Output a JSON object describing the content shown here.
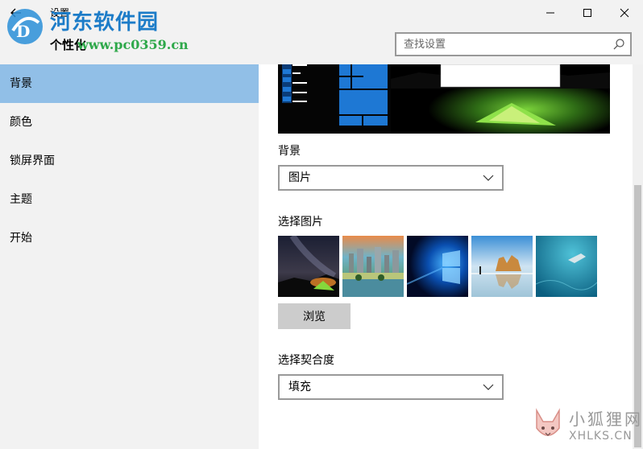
{
  "window": {
    "app_title": "设置",
    "page_title": "个性化",
    "back_icon": "back-arrow-icon",
    "min_icon": "minimize-icon",
    "max_icon": "maximize-icon",
    "close_icon": "close-icon"
  },
  "watermark": {
    "site_title": "河东软件园",
    "site_url": "www.pc0359.cn",
    "corner_cn": "小狐狸网",
    "corner_en": "XHLKS.CN"
  },
  "search": {
    "placeholder": "查找设置",
    "icon": "search-icon"
  },
  "sidebar": {
    "selected_index": 0,
    "accent": "#91bfe7",
    "items": [
      {
        "label": "背景"
      },
      {
        "label": "颜色"
      },
      {
        "label": "锁屏界面"
      },
      {
        "label": "主题"
      },
      {
        "label": "开始"
      }
    ]
  },
  "background": {
    "label": "背景",
    "selected": "图片"
  },
  "choose_picture": {
    "label": "选择图片",
    "thumbnails": [
      {
        "name": "night-tent-thumbnail"
      },
      {
        "name": "painted-city-thumbnail"
      },
      {
        "name": "windows-logo-thumbnail"
      },
      {
        "name": "beach-rocks-thumbnail"
      },
      {
        "name": "underwater-swimmer-thumbnail"
      }
    ]
  },
  "browse": {
    "label": "浏览"
  },
  "fit": {
    "label": "选择契合度",
    "selected": "填充"
  }
}
